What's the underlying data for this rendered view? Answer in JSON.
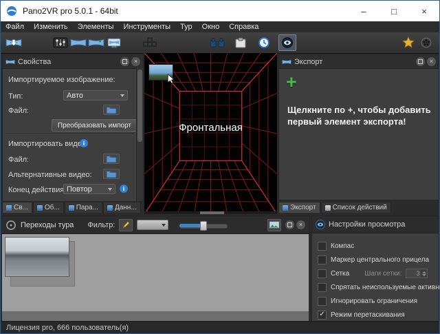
{
  "chrome": {
    "close_glyph": "×",
    "info_glyph": "i"
  },
  "window": {
    "title": "Pano2VR pro 5.0.1 - 64bit",
    "minimize": "–",
    "maximize": "□",
    "close": "×"
  },
  "menu": {
    "items": [
      "Файл",
      "Изменить",
      "Элементы",
      "Инструменты",
      "Тур",
      "Окно",
      "Справка"
    ]
  },
  "toolbar": {
    "icons": [
      "import-panorama-icon",
      "viewer-parameters-icon",
      "panorama-icon",
      "new-output-icon",
      "display-output-icon",
      "cube-faces-icon",
      "binoculars-icon",
      "clipboard-icon",
      "clock-icon",
      "eye-icon",
      "trophy-icon",
      "film-reel-icon"
    ]
  },
  "properties_panel": {
    "title": "Свойства",
    "imported_image_label": "Импортируемое изображение:",
    "type_label": "Тип:",
    "type_value": "Авто",
    "file_label": "Файл:",
    "convert_button": "Преобразовать импорт",
    "import_video_label": "Импортировать видео:",
    "file2_label": "Файл:",
    "alt_video_label": "Альтернативные видео:",
    "end_action_label": "Конец действия:",
    "end_action_value": "Повтор",
    "tabs": [
      "Св...",
      "Об...",
      "Пара...",
      "Данн..."
    ]
  },
  "preview": {
    "face_label": "Фронтальная"
  },
  "export_panel": {
    "title": "Экспорт",
    "add_symbol": "+",
    "hint": "Щелкните по +, чтобы добавить первый элемент экспорта!",
    "tabs": [
      "Экспорт",
      "Список действий"
    ]
  },
  "tour_panel": {
    "title": "Переходы тура",
    "filter_label": "Фильтр:",
    "placeholder_mark": "?"
  },
  "view_settings": {
    "title": "Настройки просмотра",
    "grid_steps_label": "Шаги сетки:",
    "grid_steps_value": "3",
    "options": [
      {
        "label": "Компас",
        "mark": ""
      },
      {
        "label": "Маркер центрального прицела",
        "mark": ""
      },
      {
        "label": "Сетка",
        "mark": ""
      },
      {
        "label": "Спрятать неиспользуемые активные зоны",
        "mark": ""
      },
      {
        "label": "Игнорировать ограничения",
        "mark": ""
      },
      {
        "label": "Режим перетаскивания",
        "mark": "✓"
      }
    ]
  },
  "status_bar": {
    "text": "Лицензия pro, 666 пользователь(я)"
  }
}
